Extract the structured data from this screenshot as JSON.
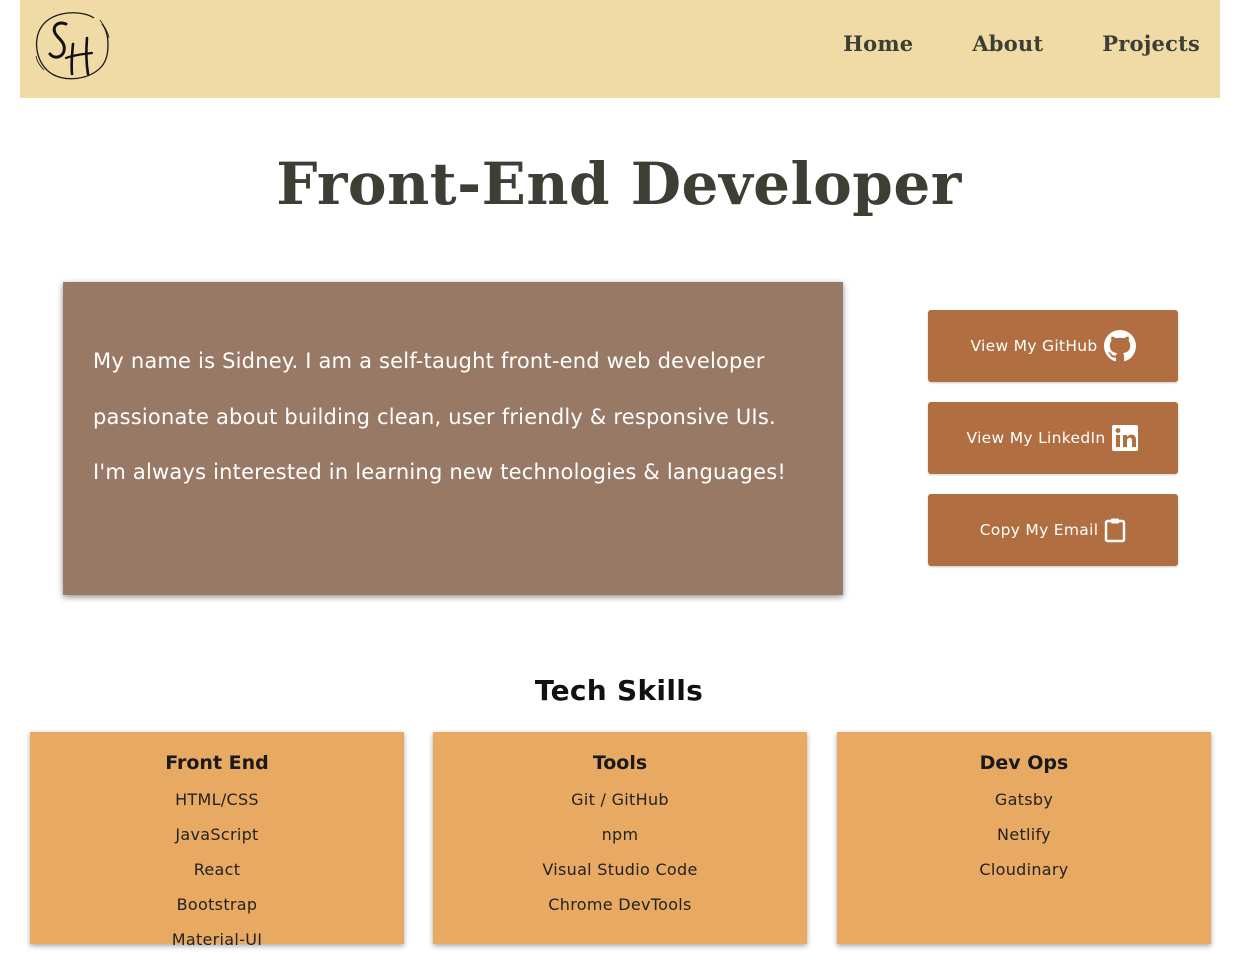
{
  "nav": {
    "logo_text": "SH",
    "items": [
      {
        "label": "Home"
      },
      {
        "label": "About"
      },
      {
        "label": "Projects"
      }
    ]
  },
  "hero": {
    "title": "Front-End Developer"
  },
  "bio": {
    "text": "My name is Sidney. I am a self-taught front-end web developer passionate about building clean, user friendly & responsive UIs. I'm always interested in learning new technologies & languages!"
  },
  "buttons": {
    "github": {
      "label": "View My GitHub",
      "icon": "github-icon"
    },
    "linkedin": {
      "label": "View My LinkedIn",
      "icon": "linkedin-icon"
    },
    "email": {
      "label": "Copy My Email",
      "icon": "clipboard-icon"
    }
  },
  "skills": {
    "title": "Tech Skills",
    "cards": [
      {
        "title": "Front End",
        "items": [
          "HTML/CSS",
          "JavaScript",
          "React",
          "Bootstrap",
          "Material-UI"
        ]
      },
      {
        "title": "Tools",
        "items": [
          "Git / GitHub",
          "npm",
          "Visual Studio Code",
          "Chrome DevTools"
        ]
      },
      {
        "title": "Dev Ops",
        "items": [
          "Gatsby",
          "Netlify",
          "Cloudinary"
        ]
      }
    ]
  },
  "colors": {
    "header_bg": "#f0dba6",
    "bio_bg": "#987965",
    "button_bg": "#b06e41",
    "card_bg": "#e8aa62",
    "title_text": "#3d3f34"
  }
}
